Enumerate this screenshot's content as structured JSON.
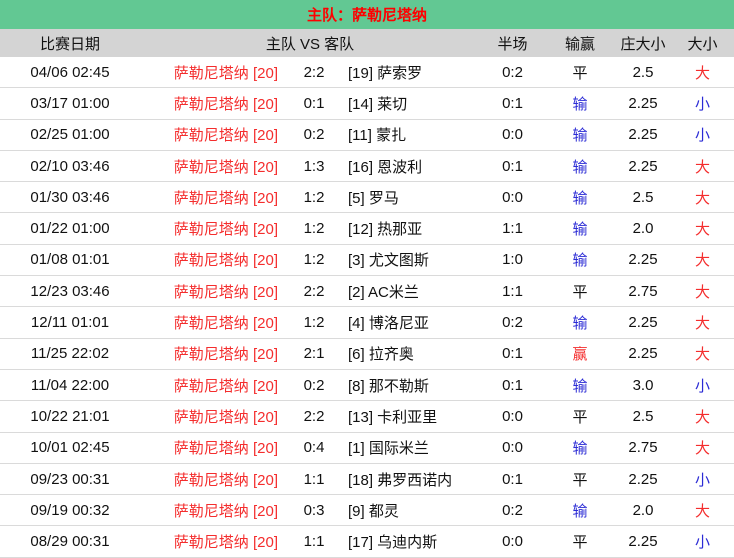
{
  "title": "主队：萨勒尼塔纳",
  "colors": {
    "title_bar_green": "#62c893",
    "title_text_red": "#ff0000",
    "data_red": "#f42d2d",
    "data_blue": "#2b2bd5",
    "header_row_gray": "#d4d4d4",
    "row_divider": "#dadada"
  },
  "columns": {
    "date": "比赛日期",
    "match": "主队 VS 客队",
    "half": "半场",
    "result": "输赢",
    "line": "庄大小",
    "over_under": "大小"
  },
  "rows": [
    {
      "date": "04/06 02:45",
      "home": "萨勒尼塔纳 [20]",
      "score": "2:2",
      "away": "[19] 萨索罗",
      "half": "0:2",
      "result": "平",
      "result_class": "neutral",
      "line": "2.5",
      "ou": "大",
      "ou_class": "red"
    },
    {
      "date": "03/17 01:00",
      "home": "萨勒尼塔纳 [20]",
      "score": "0:1",
      "away": "[14] 莱切",
      "half": "0:1",
      "result": "输",
      "result_class": "blue",
      "line": "2.25",
      "ou": "小",
      "ou_class": "blue"
    },
    {
      "date": "02/25 01:00",
      "home": "萨勒尼塔纳 [20]",
      "score": "0:2",
      "away": "[11] 蒙扎",
      "half": "0:0",
      "result": "输",
      "result_class": "blue",
      "line": "2.25",
      "ou": "小",
      "ou_class": "blue"
    },
    {
      "date": "02/10 03:46",
      "home": "萨勒尼塔纳 [20]",
      "score": "1:3",
      "away": "[16] 恩波利",
      "half": "0:1",
      "result": "输",
      "result_class": "blue",
      "line": "2.25",
      "ou": "大",
      "ou_class": "red"
    },
    {
      "date": "01/30 03:46",
      "home": "萨勒尼塔纳 [20]",
      "score": "1:2",
      "away": "[5] 罗马",
      "half": "0:0",
      "result": "输",
      "result_class": "blue",
      "line": "2.5",
      "ou": "大",
      "ou_class": "red"
    },
    {
      "date": "01/22 01:00",
      "home": "萨勒尼塔纳 [20]",
      "score": "1:2",
      "away": "[12] 热那亚",
      "half": "1:1",
      "result": "输",
      "result_class": "blue",
      "line": "2.0",
      "ou": "大",
      "ou_class": "red"
    },
    {
      "date": "01/08 01:01",
      "home": "萨勒尼塔纳 [20]",
      "score": "1:2",
      "away": "[3] 尤文图斯",
      "half": "1:0",
      "result": "输",
      "result_class": "blue",
      "line": "2.25",
      "ou": "大",
      "ou_class": "red"
    },
    {
      "date": "12/23 03:46",
      "home": "萨勒尼塔纳 [20]",
      "score": "2:2",
      "away": "[2] AC米兰",
      "half": "1:1",
      "result": "平",
      "result_class": "neutral",
      "line": "2.75",
      "ou": "大",
      "ou_class": "red"
    },
    {
      "date": "12/11 01:01",
      "home": "萨勒尼塔纳 [20]",
      "score": "1:2",
      "away": "[4] 博洛尼亚",
      "half": "0:2",
      "result": "输",
      "result_class": "blue",
      "line": "2.25",
      "ou": "大",
      "ou_class": "red"
    },
    {
      "date": "11/25 22:02",
      "home": "萨勒尼塔纳 [20]",
      "score": "2:1",
      "away": "[6] 拉齐奥",
      "half": "0:1",
      "result": "赢",
      "result_class": "red",
      "line": "2.25",
      "ou": "大",
      "ou_class": "red"
    },
    {
      "date": "11/04 22:00",
      "home": "萨勒尼塔纳 [20]",
      "score": "0:2",
      "away": "[8] 那不勒斯",
      "half": "0:1",
      "result": "输",
      "result_class": "blue",
      "line": "3.0",
      "ou": "小",
      "ou_class": "blue"
    },
    {
      "date": "10/22 21:01",
      "home": "萨勒尼塔纳 [20]",
      "score": "2:2",
      "away": "[13] 卡利亚里",
      "half": "0:0",
      "result": "平",
      "result_class": "neutral",
      "line": "2.5",
      "ou": "大",
      "ou_class": "red"
    },
    {
      "date": "10/01 02:45",
      "home": "萨勒尼塔纳 [20]",
      "score": "0:4",
      "away": "[1] 国际米兰",
      "half": "0:0",
      "result": "输",
      "result_class": "blue",
      "line": "2.75",
      "ou": "大",
      "ou_class": "red"
    },
    {
      "date": "09/23 00:31",
      "home": "萨勒尼塔纳 [20]",
      "score": "1:1",
      "away": "[18] 弗罗西诺内",
      "half": "0:1",
      "result": "平",
      "result_class": "neutral",
      "line": "2.25",
      "ou": "小",
      "ou_class": "blue"
    },
    {
      "date": "09/19 00:32",
      "home": "萨勒尼塔纳 [20]",
      "score": "0:3",
      "away": "[9] 都灵",
      "half": "0:2",
      "result": "输",
      "result_class": "blue",
      "line": "2.0",
      "ou": "大",
      "ou_class": "red"
    },
    {
      "date": "08/29 00:31",
      "home": "萨勒尼塔纳 [20]",
      "score": "1:1",
      "away": "[17] 乌迪内斯",
      "half": "0:0",
      "result": "平",
      "result_class": "neutral",
      "line": "2.25",
      "ou": "小",
      "ou_class": "blue"
    }
  ]
}
